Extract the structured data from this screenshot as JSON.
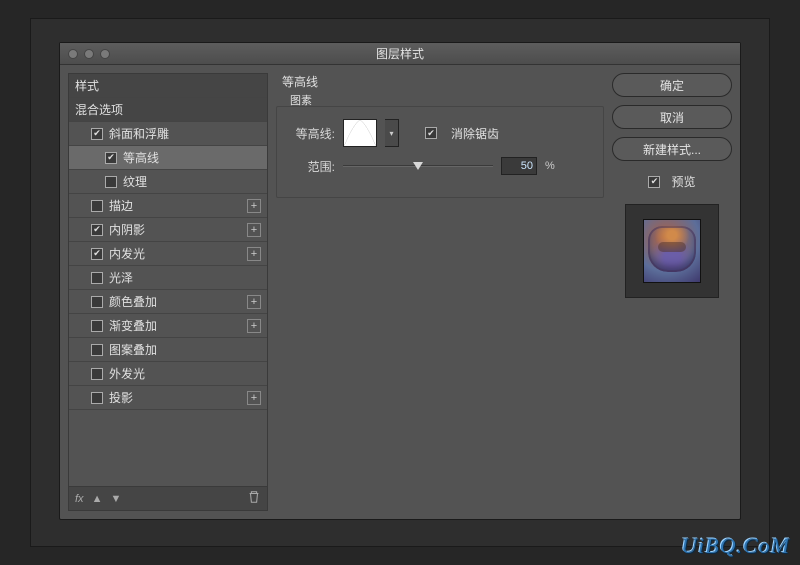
{
  "dialog": {
    "title": "图层样式"
  },
  "left": {
    "headers": {
      "styles": "样式",
      "blending": "混合选项"
    },
    "effects": {
      "bevel": "斜面和浮雕",
      "contour": "等高线",
      "texture": "纹理",
      "stroke": "描边",
      "innerShadow": "内阴影",
      "innerGlow": "内发光",
      "satin": "光泽",
      "colorOverlay": "颜色叠加",
      "gradientOverlay": "渐变叠加",
      "patternOverlay": "图案叠加",
      "outerGlow": "外发光",
      "dropShadow": "投影"
    },
    "fx_label": "fx"
  },
  "center": {
    "section": "等高线",
    "fieldset": "图素",
    "contour_label": "等高线:",
    "antialias": "消除锯齿",
    "range_label": "范围:",
    "range_value": "50",
    "pct": "%"
  },
  "right": {
    "ok": "确定",
    "cancel": "取消",
    "newStyle": "新建样式...",
    "preview": "预览"
  },
  "watermark": "UiBQ.CoM"
}
